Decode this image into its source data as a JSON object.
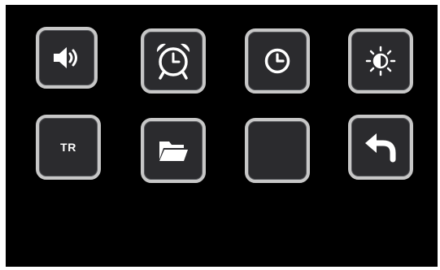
{
  "tiles": [
    {
      "id": "volume",
      "icon": "speaker-volume-icon"
    },
    {
      "id": "alarm",
      "icon": "alarm-clock-icon"
    },
    {
      "id": "clock",
      "icon": "clock-icon"
    },
    {
      "id": "brightness",
      "icon": "brightness-icon"
    },
    {
      "id": "language",
      "label": "TR"
    },
    {
      "id": "folder",
      "icon": "folder-icon"
    },
    {
      "id": "blank",
      "icon": ""
    },
    {
      "id": "back",
      "icon": "back-arrow-icon"
    }
  ],
  "colors": {
    "screen_background": "#000000",
    "tile_fill": "#2b2b2e",
    "tile_border": "#c7c7c7",
    "icon": "#ffffff"
  }
}
